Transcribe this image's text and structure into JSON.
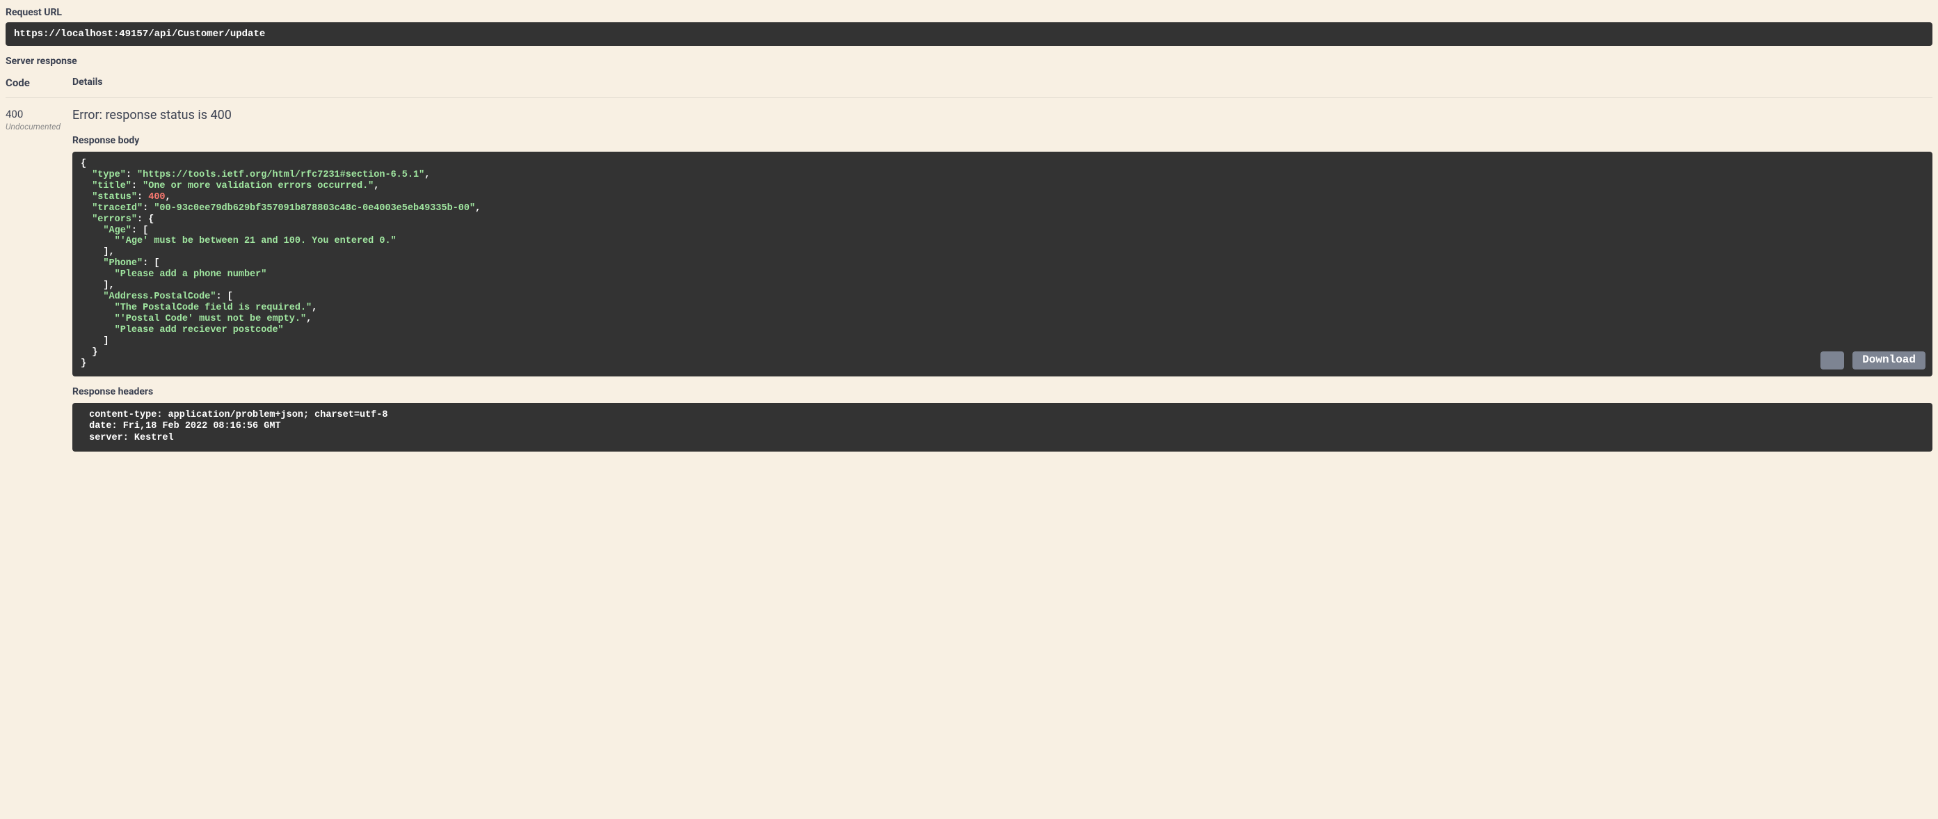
{
  "labels": {
    "request_url": "Request URL",
    "server_response": "Server response",
    "code": "Code",
    "details": "Details",
    "response_body": "Response body",
    "response_headers": "Response headers",
    "download": "Download"
  },
  "request": {
    "url": "https://localhost:49157/api/Customer/update"
  },
  "response": {
    "code": "400",
    "undocumented": "Undocumented",
    "error_line": "Error: response status is 400",
    "body": {
      "type": "https://tools.ietf.org/html/rfc7231#section-6.5.1",
      "title": "One or more validation errors occurred.",
      "status": 400,
      "traceId": "00-93c0ee79db629bf357091b878803c48c-0e4003e5eb49335b-00",
      "errors": {
        "Age": [
          "'Age' must be between 21 and 100. You entered 0."
        ],
        "Phone": [
          "Please add a phone number"
        ],
        "Address.PostalCode": [
          "The PostalCode field is required.",
          "'Postal Code' must not be empty.",
          "Please add reciever postcode"
        ]
      }
    },
    "headers": {
      "content-type": "application/problem+json; charset=utf-8",
      "date": "Fri,18 Feb 2022 08:16:56 GMT",
      "server": "Kestrel"
    }
  }
}
